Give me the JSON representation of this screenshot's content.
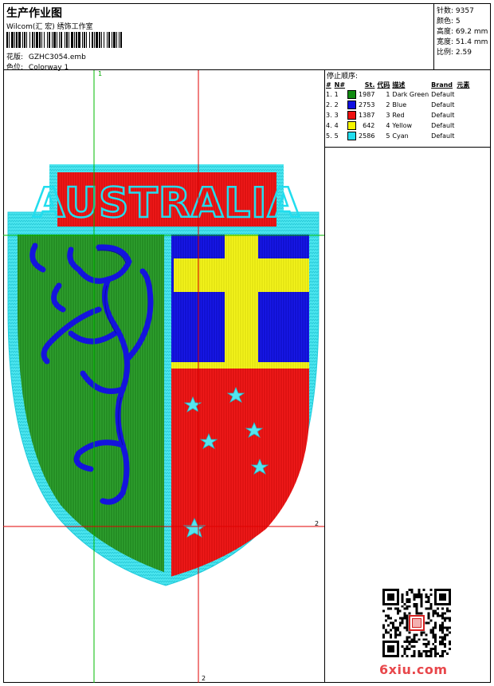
{
  "header": {
    "title": "生产作业图",
    "subtitle": "Wilcom(汇 宏) 绣饰工作室",
    "design_label": "花版:",
    "design_value": "GZHC3054.emb",
    "colorway_label": "色位:",
    "colorway_value": "Colorway 1"
  },
  "stats": [
    {
      "label": "针数:",
      "value": "9357"
    },
    {
      "label": "颜色:",
      "value": "5"
    },
    {
      "label": "高度:",
      "value": "69.2 mm"
    },
    {
      "label": "宽度:",
      "value": "51.4 mm"
    },
    {
      "label": "比例:",
      "value": "2.59"
    }
  ],
  "stop_sequence": {
    "title": "停止顺序:",
    "headers": [
      "#",
      "N#",
      "St.",
      "代码",
      "描述",
      "Brand",
      "元素"
    ],
    "rows": [
      {
        "idx": "1.",
        "n": "1",
        "color": "#118A11",
        "st": "1987",
        "code": "1",
        "desc": "Dark Green",
        "brand": "Default"
      },
      {
        "idx": "2.",
        "n": "2",
        "color": "#1010E0",
        "st": "2753",
        "code": "2",
        "desc": "Blue",
        "brand": "Default"
      },
      {
        "idx": "3.",
        "n": "3",
        "color": "#EE1111",
        "st": "1387",
        "code": "3",
        "desc": "Red",
        "brand": "Default"
      },
      {
        "idx": "4.",
        "n": "4",
        "color": "#F5F500",
        "st": "642",
        "code": "4",
        "desc": "Yellow",
        "brand": "Default"
      },
      {
        "idx": "5.",
        "n": "5",
        "color": "#22DDEE",
        "st": "2586",
        "code": "5",
        "desc": "Cyan",
        "brand": "Default"
      }
    ]
  },
  "design": {
    "banner_text": "AUSTRALIA",
    "guide_labels": {
      "v1": "1",
      "h2": "2",
      "v2": "2"
    }
  },
  "watermark": "6xiu.com",
  "colors": {
    "green": "#2E9A2E",
    "blue": "#1212DD",
    "red": "#EE1515",
    "yellow": "#F2F21A",
    "cyan": "#3DE0EA",
    "guide_green": "#00BB00",
    "guide_red": "#E00000"
  }
}
